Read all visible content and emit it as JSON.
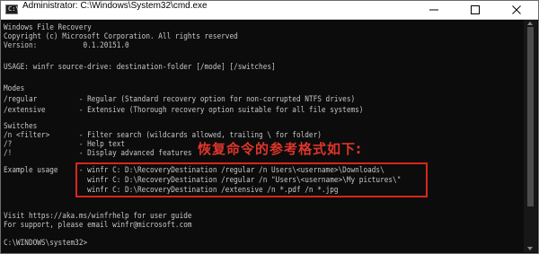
{
  "window": {
    "title": "Administrator: C:\\Windows\\System32\\cmd.exe",
    "icon": "cmd-icon",
    "controls": [
      "minimize-icon",
      "maximize-icon",
      "close-icon"
    ]
  },
  "console": {
    "lines": [
      "Windows File Recovery",
      "Copyright (c) Microsoft Corporation. All rights reserved",
      "Version:           0.1.20151.0",
      "",
      "USAGE: winfr source-drive: destination-folder [/mode] [/switches]",
      "",
      "Modes",
      "/regular          - Regular (Standard recovery option for non-corrupted NTFS drives)",
      "/extensive        - Extensive (Thorough recovery option suitable for all file systems)",
      "",
      "Switches",
      "/n <filter>       - Filter search (wildcards allowed, trailing \\ for folder)",
      "/?                - Help text",
      "/!                - Display advanced features",
      "",
      "Example usage     - winfr C: D:\\RecoveryDestination /regular /n Users\\<username>\\Downloads\\",
      "                    winfr C: D:\\RecoveryDestination /regular /n \"Users\\<username>\\My pictures\\\"",
      "                    winfr C: D:\\RecoveryDestination /extensive /n *.pdf /n *.jpg",
      "",
      "",
      "Visit https://aka.ms/winfrhelp for user guide",
      "For support, please email winfr@microsoft.com",
      "",
      "C:\\WINDOWS\\system32>"
    ]
  },
  "annotation": {
    "text": "恢复命令的参考格式如下:",
    "color": "#e0352b"
  },
  "colors": {
    "console_bg": "#0c0c0c",
    "console_text": "#c8c8c8",
    "highlight_box": "#d9261c"
  }
}
